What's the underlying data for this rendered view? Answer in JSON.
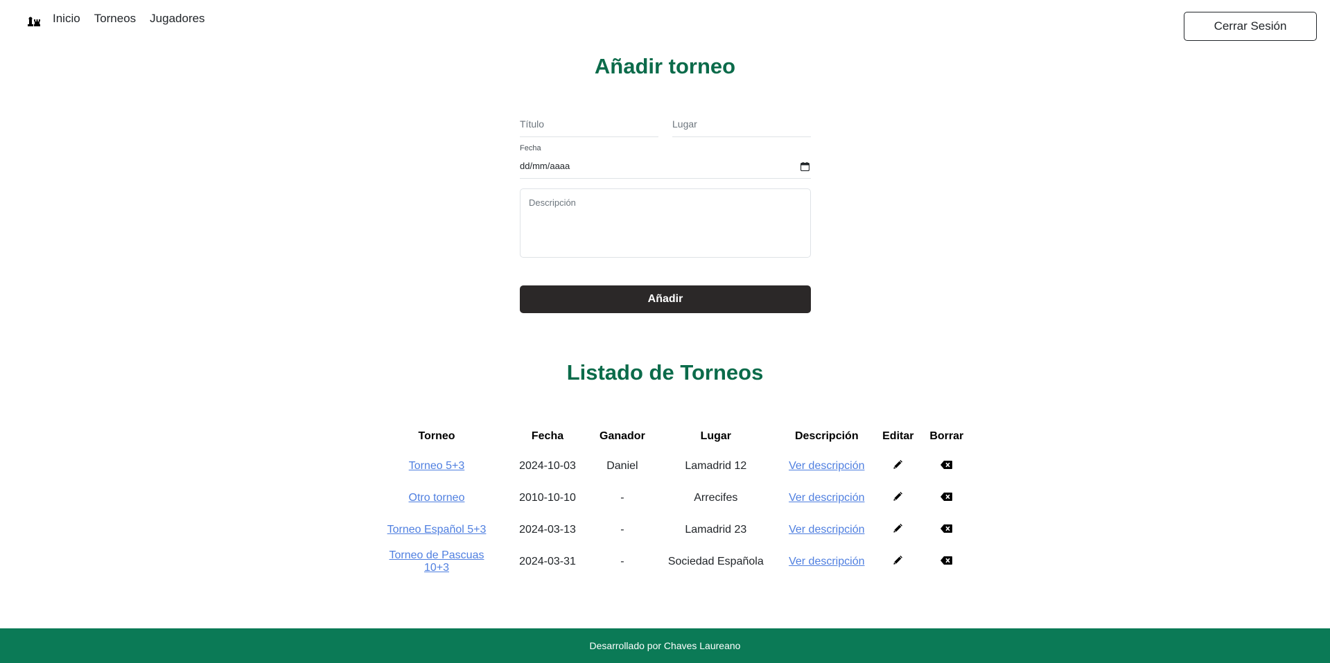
{
  "nav": {
    "brand_icon": "chess-pieces-icon",
    "links": [
      {
        "label": "Inicio"
      },
      {
        "label": "Torneos"
      },
      {
        "label": "Jugadores"
      }
    ],
    "logout_label": "Cerrar Sesión"
  },
  "add_form": {
    "title": "Añadir torneo",
    "titulo_placeholder": "Título",
    "lugar_placeholder": "Lugar",
    "fecha_label": "Fecha",
    "fecha_value": "dd/mm/aaaa",
    "descripcion_placeholder": "Descripción",
    "submit_label": "Añadir"
  },
  "list": {
    "title": "Listado de Torneos",
    "headers": [
      "Torneo",
      "Fecha",
      "Ganador",
      "Lugar",
      "Descripción",
      "Editar",
      "Borrar"
    ],
    "rows": [
      {
        "torneo": "Torneo 5+3",
        "fecha": "2024-10-03",
        "ganador": "Daniel",
        "lugar": "Lamadrid 12",
        "descripcion": "Ver descripción"
      },
      {
        "torneo": "Otro torneo",
        "fecha": "2010-10-10",
        "ganador": "-",
        "lugar": "Arrecifes",
        "descripcion": "Ver descripción"
      },
      {
        "torneo": "Torneo Español 5+3",
        "fecha": "2024-03-13",
        "ganador": "-",
        "lugar": "Lamadrid 23",
        "descripcion": "Ver descripción"
      },
      {
        "torneo": "Torneo de Pascuas 10+3",
        "fecha": "2024-03-31",
        "ganador": "-",
        "lugar": "Sociedad Española",
        "descripcion": "Ver descripción"
      }
    ]
  },
  "footer": {
    "text": "Desarrollado por Chaves Laureano"
  },
  "colors": {
    "accent": "#0b6b4a",
    "footer_bg": "#0b7a56",
    "link": "#4f7fe0",
    "button_dark": "#2b2828"
  }
}
